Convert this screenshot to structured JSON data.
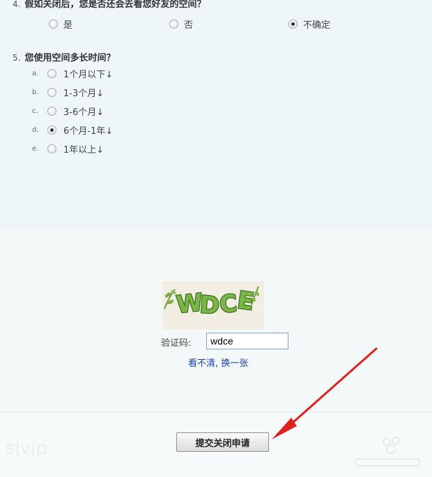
{
  "survey": {
    "q4": {
      "number": "4.",
      "title": "假如关闭后，您是否还会去看您好友的空间？",
      "options": [
        {
          "label": "是",
          "selected": false
        },
        {
          "label": "否",
          "selected": false
        },
        {
          "label": "不确定",
          "selected": true
        }
      ]
    },
    "q5": {
      "number": "5.",
      "title": "您使用空间多长时间？",
      "options": [
        {
          "letter": "a.",
          "label": "1个月以下↓",
          "selected": false
        },
        {
          "letter": "b.",
          "label": "1-3个月↓",
          "selected": false
        },
        {
          "letter": "c.",
          "label": "3-6个月↓",
          "selected": false
        },
        {
          "letter": "d.",
          "label": "6个月-1年↓",
          "selected": true
        },
        {
          "letter": "e.",
          "label": "1年以上↓",
          "selected": false
        }
      ]
    }
  },
  "captcha": {
    "image_text": "WDCE",
    "label": "验证码:",
    "value": "wdce",
    "refresh_link": "看不清, 换一张"
  },
  "submit": {
    "label": "提交关闭申请"
  },
  "watermark": {
    "left_text": "sjvip"
  },
  "annotation": {
    "arrow_color": "#e0201c"
  }
}
